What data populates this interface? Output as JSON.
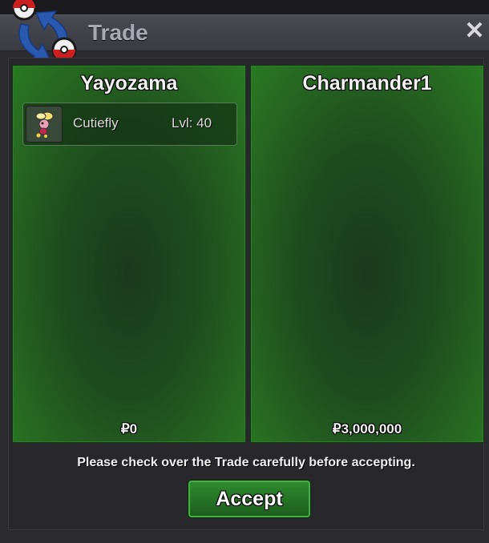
{
  "window": {
    "title": "Trade",
    "close_label": "✕"
  },
  "left_player": {
    "name": "Yayozama",
    "items": [
      {
        "name": "Cutiefly",
        "level": "Lvl: 40"
      }
    ],
    "money": "₽0"
  },
  "right_player": {
    "name": "Charmander1",
    "items": [],
    "money": "₽3,000,000"
  },
  "notice": "Please check over the Trade carefully before accepting.",
  "accept_label": "Accept",
  "colors": {
    "panel_green": "#2a7a22",
    "button_green": "#2e8a2e"
  }
}
